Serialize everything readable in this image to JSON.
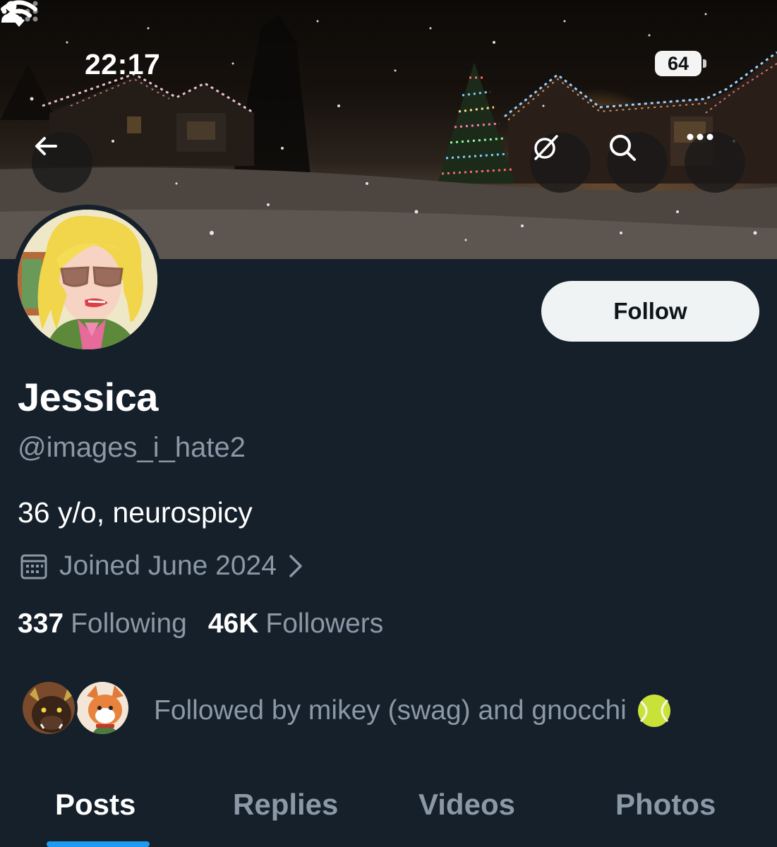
{
  "status_bar": {
    "time": "22:17",
    "battery": "64",
    "icons": [
      "person-icon",
      "signal-icon",
      "wifi-icon",
      "battery-icon"
    ]
  },
  "header_buttons": {
    "back": "back-arrow-icon",
    "grok": "grok-icon",
    "search": "search-icon",
    "more": "more-icon"
  },
  "profile": {
    "display_name": "Jessica",
    "handle": "@images_i_hate2",
    "bio": "36 y/o, neurospicy",
    "joined": "Joined June 2024",
    "follow_label": "Follow",
    "following_count": "337",
    "following_label": "Following",
    "followers_count": "46K",
    "followers_label": "Followers",
    "followed_by": "Followed by mikey (swag) and gnocchi",
    "followed_by_emoji": "tennis-ball-icon"
  },
  "tabs": [
    {
      "label": "Posts",
      "active": true
    },
    {
      "label": "Replies",
      "active": false
    },
    {
      "label": "Videos",
      "active": false
    },
    {
      "label": "Photos",
      "active": false
    }
  ],
  "colors": {
    "background": "#15202b",
    "accent": "#1d9bf0",
    "muted_text": "#8b98a5",
    "follow_button": "#eff3f4"
  }
}
